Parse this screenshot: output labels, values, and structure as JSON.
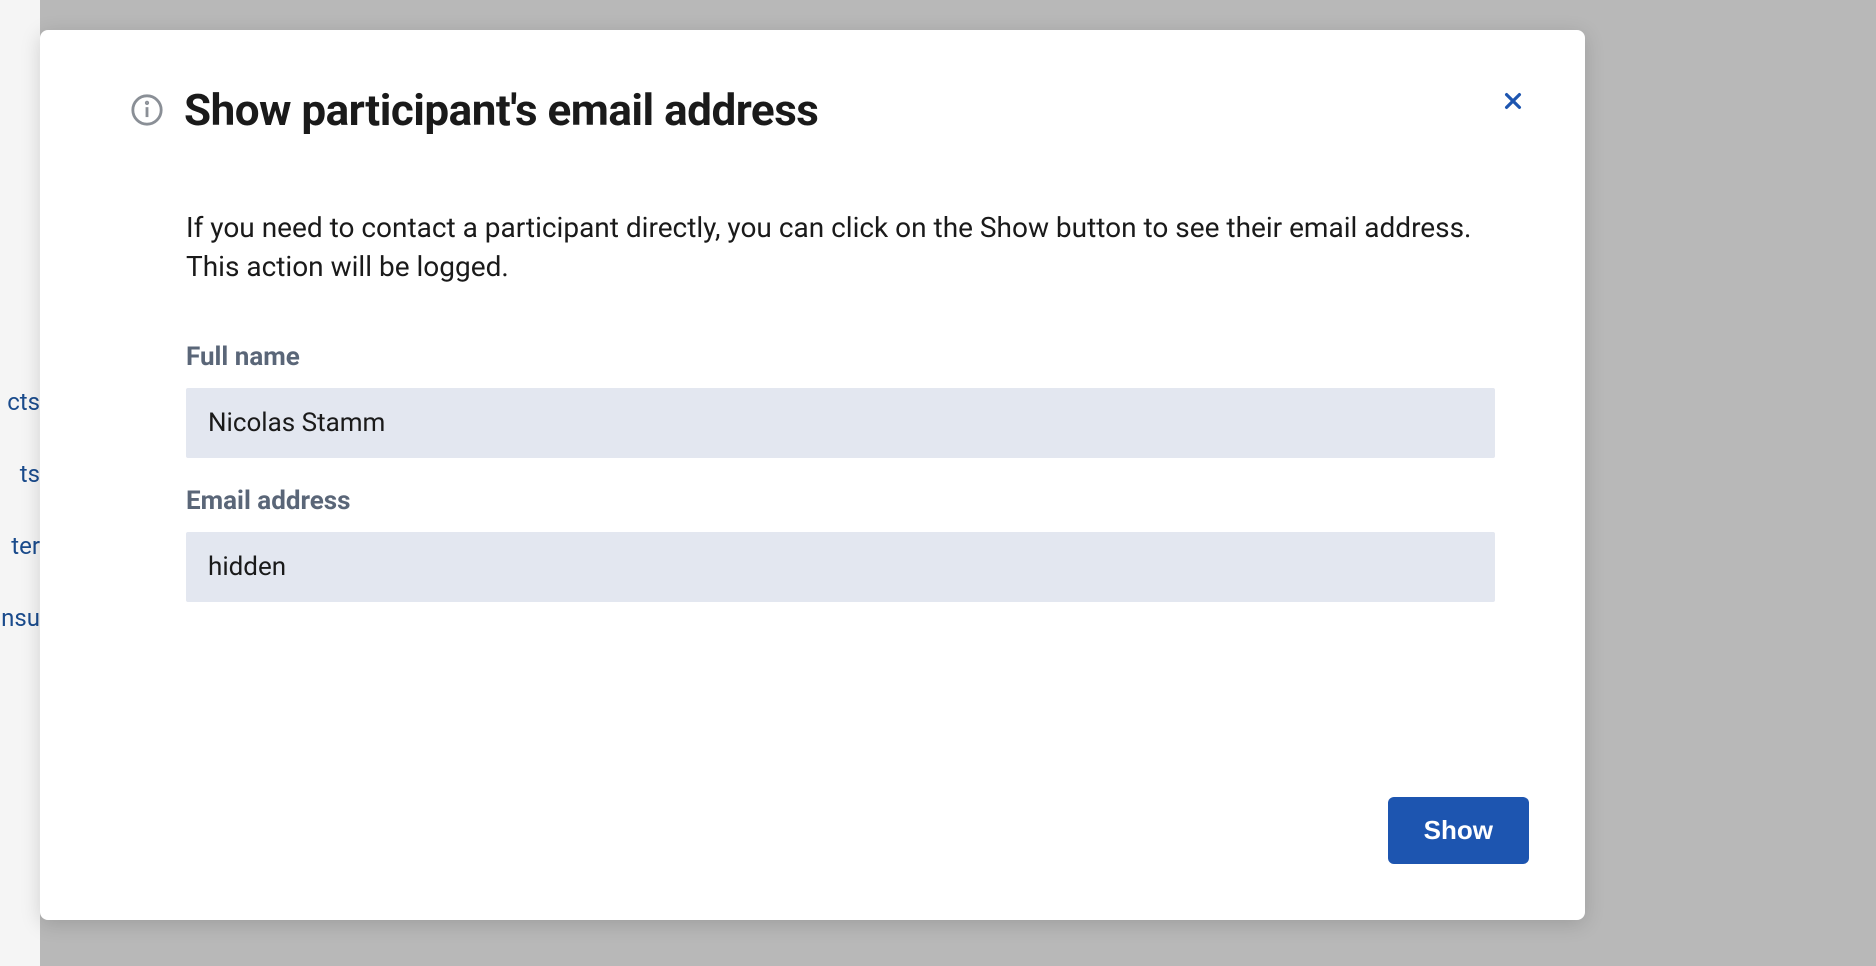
{
  "backdrop": {
    "nav_items": [
      "cts",
      "ts",
      "ter",
      "nsu"
    ]
  },
  "modal": {
    "title": "Show participant's email address",
    "description": "If you need to contact a participant directly, you can click on the Show button to see their email address. This action will be logged.",
    "fields": {
      "full_name": {
        "label": "Full name",
        "value": "Nicolas Stamm"
      },
      "email": {
        "label": "Email address",
        "value": "hidden"
      }
    },
    "buttons": {
      "show": "Show"
    }
  }
}
